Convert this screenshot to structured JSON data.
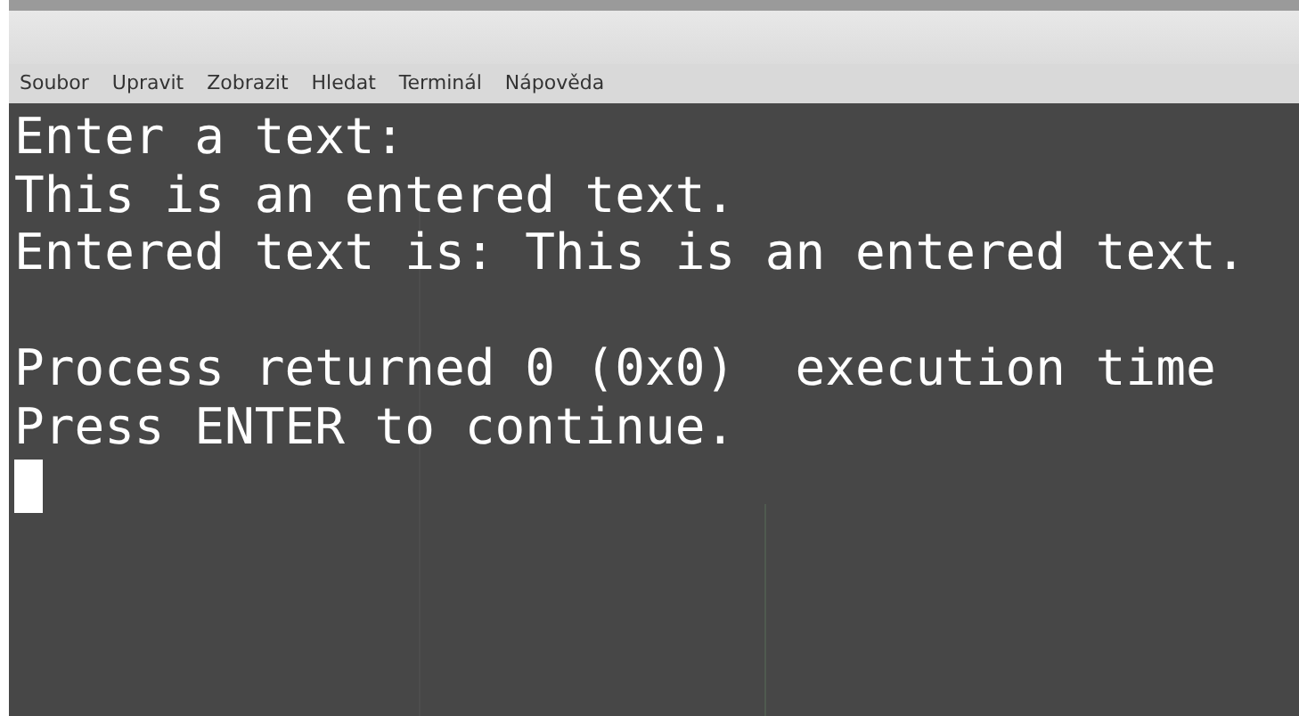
{
  "menu_bar": [
    "Soubor",
    "Upravit",
    "Zobrazit",
    "Hledat",
    "Terminál",
    "Nápověda"
  ],
  "terminal": {
    "blocks": [
      [
        "Enter a text:",
        "This is an entered text.",
        "Entered text is: This is an entered text."
      ],
      [
        "Process returned 0 (0x0)  execution time",
        "Press ENTER to continue."
      ]
    ],
    "cursor": true
  }
}
